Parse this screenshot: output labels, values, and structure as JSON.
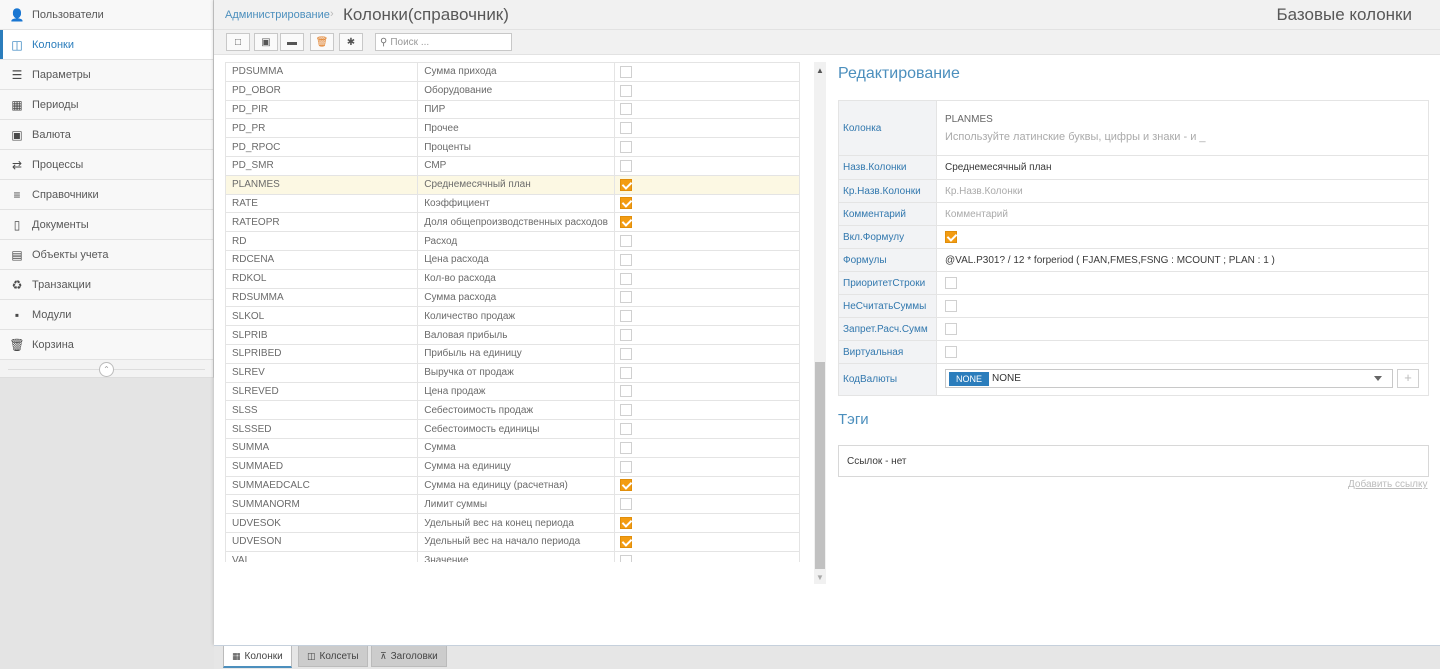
{
  "sidebar": {
    "items": [
      {
        "label": "Пользователи",
        "icon": "user-secret-icon",
        "glyph": "👤",
        "active": false
      },
      {
        "label": "Колонки",
        "icon": "columns-icon",
        "glyph": "◫",
        "active": true
      },
      {
        "label": "Параметры",
        "icon": "sliders-icon",
        "glyph": "☰",
        "active": false
      },
      {
        "label": "Периоды",
        "icon": "calendar-icon",
        "glyph": "▦",
        "active": false
      },
      {
        "label": "Валюта",
        "icon": "money-icon",
        "glyph": "▣",
        "active": false
      },
      {
        "label": "Процессы",
        "icon": "handshake-icon",
        "glyph": "⇄",
        "active": false
      },
      {
        "label": "Справочники",
        "icon": "list-icon",
        "glyph": "≡",
        "active": false
      },
      {
        "label": "Документы",
        "icon": "file-icon",
        "glyph": "▯",
        "active": false
      },
      {
        "label": "Объекты учета",
        "icon": "clipboard-icon",
        "glyph": "▤",
        "active": false
      },
      {
        "label": "Транзакции",
        "icon": "recycle-icon",
        "glyph": "♻",
        "active": false
      },
      {
        "label": "Модули",
        "icon": "th-large-icon",
        "glyph": "▪",
        "active": false
      },
      {
        "label": "Корзина",
        "icon": "trash-icon",
        "glyph": "🗑",
        "active": false
      }
    ],
    "collapse_glyph": "⌃"
  },
  "header": {
    "breadcrumb": "Администрирование",
    "separator": "›",
    "title": "Колонки(справочник)",
    "subtitle": "Базовые колонки"
  },
  "toolbar": {
    "search_placeholder": "Поиск ...",
    "buttons": [
      {
        "name": "new-button",
        "icon": "file-o-icon",
        "glyph": "□"
      },
      {
        "name": "export-button",
        "icon": "file-excel-icon",
        "glyph": "▣"
      },
      {
        "name": "save-button",
        "icon": "floppy-icon",
        "glyph": "▬"
      },
      {
        "name": "delete-button",
        "icon": "trash-icon",
        "glyph": "🗑"
      },
      {
        "name": "settings-button",
        "icon": "gear-icon",
        "glyph": "✱"
      }
    ]
  },
  "grid": {
    "rows": [
      {
        "code": "PDSUMMA",
        "name": "Сумма прихода",
        "checked": false
      },
      {
        "code": "PD_OBOR",
        "name": "Оборудование",
        "checked": false
      },
      {
        "code": "PD_PIR",
        "name": "ПИР",
        "checked": false
      },
      {
        "code": "PD_PR",
        "name": "Прочее",
        "checked": false
      },
      {
        "code": "PD_RPOC",
        "name": "Проценты",
        "checked": false
      },
      {
        "code": "PD_SMR",
        "name": "СМР",
        "checked": false
      },
      {
        "code": "PLANMES",
        "name": "Среднемесячный план",
        "checked": true,
        "selected": true
      },
      {
        "code": "RATE",
        "name": "Коэффициент",
        "checked": true
      },
      {
        "code": "RATEOPR",
        "name": "Доля общепроизводственных расходов",
        "checked": true
      },
      {
        "code": "RD",
        "name": "Расход",
        "checked": false
      },
      {
        "code": "RDCENA",
        "name": "Цена расхода",
        "checked": false
      },
      {
        "code": "RDKOL",
        "name": "Кол-во расхода",
        "checked": false
      },
      {
        "code": "RDSUMMA",
        "name": "Сумма расхода",
        "checked": false
      },
      {
        "code": "SLKOL",
        "name": "Количество продаж",
        "checked": false
      },
      {
        "code": "SLPRIB",
        "name": "Валовая прибыль",
        "checked": false
      },
      {
        "code": "SLPRIBED",
        "name": "Прибыль на единицу",
        "checked": false
      },
      {
        "code": "SLREV",
        "name": "Выручка от продаж",
        "checked": false
      },
      {
        "code": "SLREVED",
        "name": "Цена продаж",
        "checked": false
      },
      {
        "code": "SLSS",
        "name": "Себестоимость продаж",
        "checked": false
      },
      {
        "code": "SLSSED",
        "name": "Себестоимость единицы",
        "checked": false
      },
      {
        "code": "SUMMA",
        "name": "Сумма",
        "checked": false
      },
      {
        "code": "SUMMAED",
        "name": "Сумма на единицу",
        "checked": false
      },
      {
        "code": "SUMMAEDCALC",
        "name": "Сумма на единицу (расчетная)",
        "checked": true
      },
      {
        "code": "SUMMANORM",
        "name": "Лимит суммы",
        "checked": false
      },
      {
        "code": "UDVESOK",
        "name": "Удельный вес на конец периода",
        "checked": true
      },
      {
        "code": "UDVESON",
        "name": "Удельный вес на начало периода",
        "checked": true
      },
      {
        "code": "VAL",
        "name": "Значение",
        "checked": false
      }
    ]
  },
  "edit": {
    "title": "Редактирование",
    "column_label": "Колонка",
    "column_value": "PLANMES",
    "column_hint": "Используйте латинские буквы, цифры и знаки - и _",
    "name_label": "Назв.Колонки",
    "name_value": "Среднемесячный план",
    "short_label": "Кр.Назв.Колонки",
    "short_placeholder": "Кр.Назв.Колонки",
    "comment_label": "Комментарий",
    "comment_placeholder": "Комментарий",
    "formula_on_label": "Вкл.Формулу",
    "formula_on": true,
    "formulas_label": "Формулы",
    "formulas_value": "@VAL.P301? / 12 * forperiod ( FJAN,FMES,FSNG : MCOUNT ; PLAN : 1 )",
    "priority_label": "ПриоритетСтроки",
    "priority": false,
    "nosum_label": "НеСчитатьСуммы",
    "nosum": false,
    "nocalc_label": "Запрет.Расч.Сумм",
    "nocalc": false,
    "virtual_label": "Виртуальная",
    "virtual": false,
    "currency_label": "КодВалюты",
    "currency_chip": "NONE",
    "currency_value": "NONE",
    "plus": "+"
  },
  "tags": {
    "title": "Тэги",
    "links_text": "Ссылок - нет",
    "add_link": "Добавить ссылку"
  },
  "bottom_tabs": [
    {
      "label": "Колонки",
      "icon": "table-icon",
      "glyph": "▦",
      "active": true
    },
    {
      "label": "Колсеты",
      "icon": "columns-icon",
      "glyph": "◫",
      "active": false
    },
    {
      "label": "Заголовки",
      "icon": "sitemap-icon",
      "glyph": "⊼",
      "active": false
    }
  ]
}
